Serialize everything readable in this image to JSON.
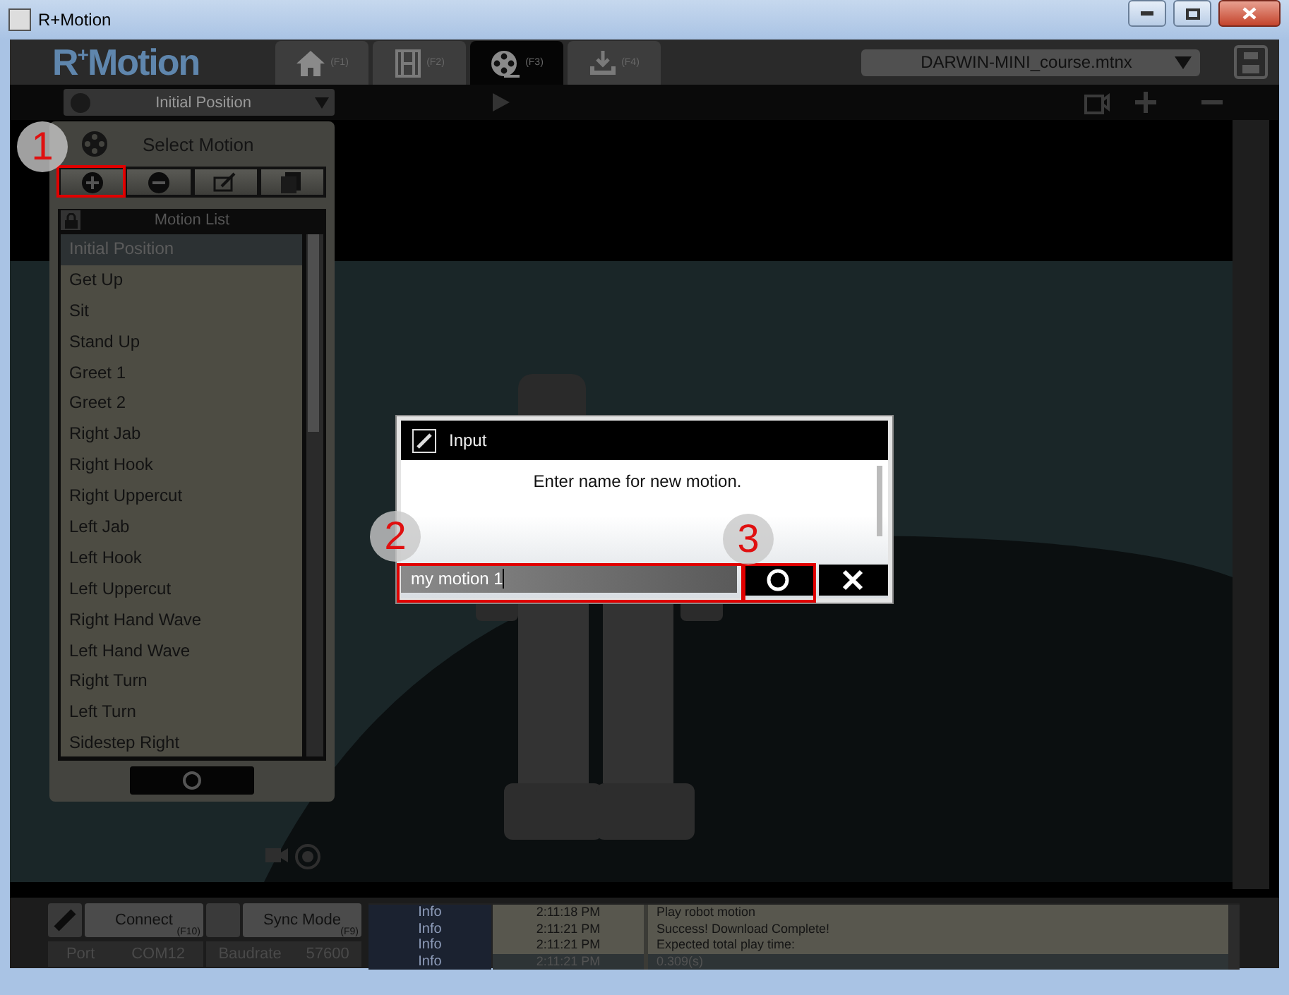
{
  "window": {
    "title": "R+Motion"
  },
  "app_bar": {
    "logo": "R$^{+}$Motion",
    "tabs": [
      {
        "kind": "home",
        "shortcut": "(F1)",
        "selected": false
      },
      {
        "kind": "film",
        "shortcut": "(F2)",
        "selected": false
      },
      {
        "kind": "reel",
        "shortcut": "(F3)",
        "selected": true
      },
      {
        "kind": "download",
        "shortcut": "(F4)",
        "selected": false
      }
    ],
    "file_select": {
      "value": "DARWIN-MINI_course.mtnx"
    }
  },
  "motion_toolbar": {
    "current_motion": "Initial Position"
  },
  "motion_panel": {
    "title": "Select Motion",
    "list_title": "Motion List",
    "items": [
      {
        "label": "Initial Position",
        "selected": true
      },
      {
        "label": "Get Up",
        "selected": false
      },
      {
        "label": "Sit",
        "selected": false
      },
      {
        "label": "Stand Up",
        "selected": false
      },
      {
        "label": "Greet 1",
        "selected": false
      },
      {
        "label": "Greet 2",
        "selected": false
      },
      {
        "label": "Right Jab",
        "selected": false
      },
      {
        "label": "Right Hook",
        "selected": false
      },
      {
        "label": "Right Uppercut",
        "selected": false
      },
      {
        "label": "Left Jab",
        "selected": false
      },
      {
        "label": "Left Hook",
        "selected": false
      },
      {
        "label": "Left Uppercut",
        "selected": false
      },
      {
        "label": "Right Hand Wave",
        "selected": false
      },
      {
        "label": "Left Hand Wave",
        "selected": false
      },
      {
        "label": "Right Turn",
        "selected": false
      },
      {
        "label": "Left Turn",
        "selected": false
      },
      {
        "label": "Sidestep Right",
        "selected": false
      }
    ]
  },
  "dialog": {
    "title": "Input",
    "message": "Enter name for new motion.",
    "value": "my motion 1"
  },
  "annotations": [
    {
      "label": "1"
    },
    {
      "label": "2"
    },
    {
      "label": "3"
    }
  ],
  "connection": {
    "connect_label": "Connect",
    "connect_shortcut": "(F10)",
    "sync_label": "Sync Mode",
    "sync_shortcut": "(F9)",
    "port_label": "Port",
    "port": "COM12",
    "baudrate_label": "Baudrate",
    "baudrate": "57600"
  },
  "log": {
    "rows": [
      {
        "level": "Info",
        "time": "2:11:18 PM",
        "message": "Play robot motion"
      },
      {
        "level": "Info",
        "time": "2:11:21 PM",
        "message": "Success! Download Complete!"
      },
      {
        "level": "Info",
        "time": "2:11:21 PM",
        "message": "Expected total play time:"
      },
      {
        "level": "Info",
        "time": "2:11:21 PM",
        "message": "0.309(s)"
      }
    ]
  }
}
